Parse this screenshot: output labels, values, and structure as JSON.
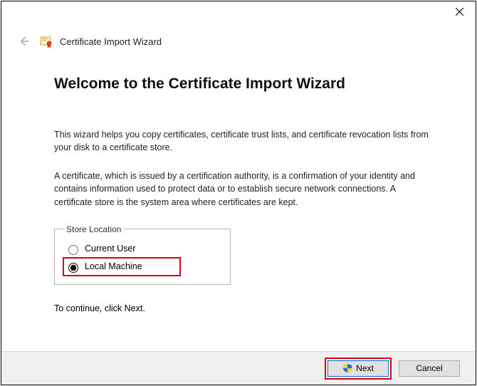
{
  "window": {
    "title": "Certificate Import Wizard"
  },
  "heading": "Welcome to the Certificate Import Wizard",
  "paragraph1": "This wizard helps you copy certificates, certificate trust lists, and certificate revocation lists from your disk to a certificate store.",
  "paragraph2": "A certificate, which is issued by a certification authority, is a confirmation of your identity and contains information used to protect data or to establish secure network connections. A certificate store is the system area where certificates are kept.",
  "store_location": {
    "legend": "Store Location",
    "options": [
      {
        "label": "Current User",
        "value": "current_user",
        "selected": false
      },
      {
        "label": "Local Machine",
        "value": "local_machine",
        "selected": true
      }
    ]
  },
  "continue_text": "To continue, click Next.",
  "buttons": {
    "next": "Next",
    "cancel": "Cancel"
  }
}
